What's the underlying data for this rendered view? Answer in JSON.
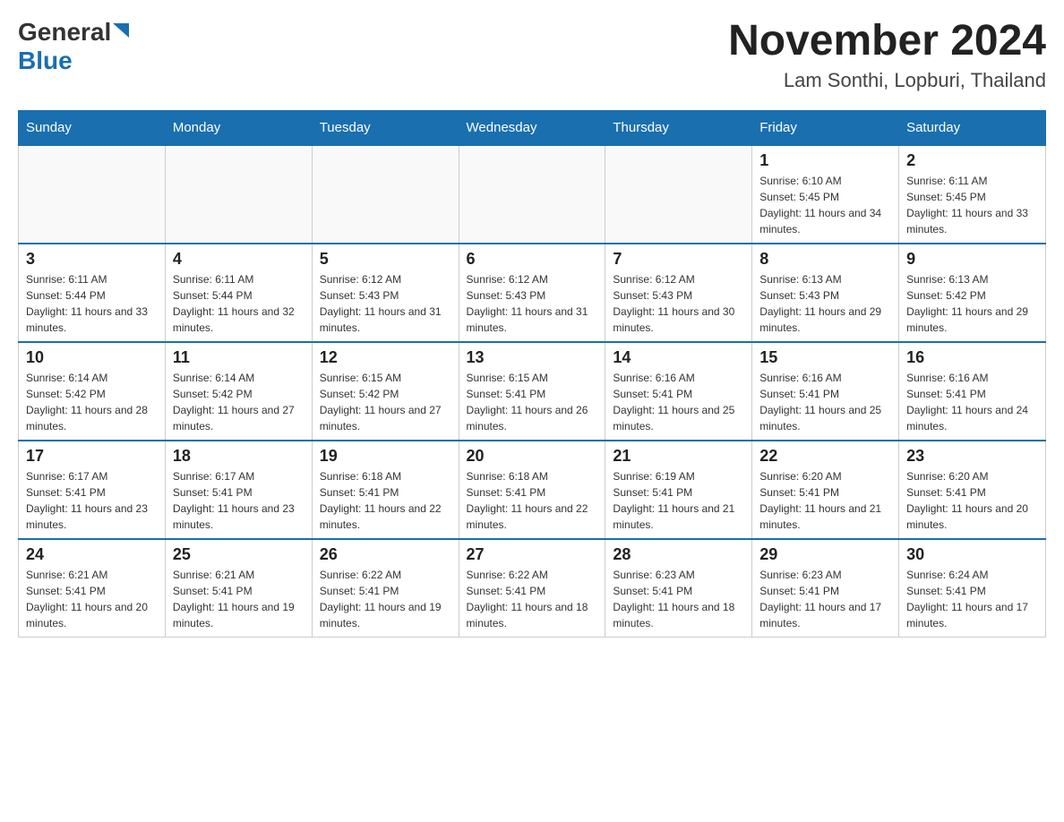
{
  "header": {
    "logo_general": "General",
    "logo_blue": "Blue",
    "title": "November 2024",
    "subtitle": "Lam Sonthi, Lopburi, Thailand"
  },
  "days_of_week": [
    "Sunday",
    "Monday",
    "Tuesday",
    "Wednesday",
    "Thursday",
    "Friday",
    "Saturday"
  ],
  "weeks": [
    {
      "days": [
        {
          "number": "",
          "info": ""
        },
        {
          "number": "",
          "info": ""
        },
        {
          "number": "",
          "info": ""
        },
        {
          "number": "",
          "info": ""
        },
        {
          "number": "",
          "info": ""
        },
        {
          "number": "1",
          "info": "Sunrise: 6:10 AM\nSunset: 5:45 PM\nDaylight: 11 hours and 34 minutes."
        },
        {
          "number": "2",
          "info": "Sunrise: 6:11 AM\nSunset: 5:45 PM\nDaylight: 11 hours and 33 minutes."
        }
      ]
    },
    {
      "days": [
        {
          "number": "3",
          "info": "Sunrise: 6:11 AM\nSunset: 5:44 PM\nDaylight: 11 hours and 33 minutes."
        },
        {
          "number": "4",
          "info": "Sunrise: 6:11 AM\nSunset: 5:44 PM\nDaylight: 11 hours and 32 minutes."
        },
        {
          "number": "5",
          "info": "Sunrise: 6:12 AM\nSunset: 5:43 PM\nDaylight: 11 hours and 31 minutes."
        },
        {
          "number": "6",
          "info": "Sunrise: 6:12 AM\nSunset: 5:43 PM\nDaylight: 11 hours and 31 minutes."
        },
        {
          "number": "7",
          "info": "Sunrise: 6:12 AM\nSunset: 5:43 PM\nDaylight: 11 hours and 30 minutes."
        },
        {
          "number": "8",
          "info": "Sunrise: 6:13 AM\nSunset: 5:43 PM\nDaylight: 11 hours and 29 minutes."
        },
        {
          "number": "9",
          "info": "Sunrise: 6:13 AM\nSunset: 5:42 PM\nDaylight: 11 hours and 29 minutes."
        }
      ]
    },
    {
      "days": [
        {
          "number": "10",
          "info": "Sunrise: 6:14 AM\nSunset: 5:42 PM\nDaylight: 11 hours and 28 minutes."
        },
        {
          "number": "11",
          "info": "Sunrise: 6:14 AM\nSunset: 5:42 PM\nDaylight: 11 hours and 27 minutes."
        },
        {
          "number": "12",
          "info": "Sunrise: 6:15 AM\nSunset: 5:42 PM\nDaylight: 11 hours and 27 minutes."
        },
        {
          "number": "13",
          "info": "Sunrise: 6:15 AM\nSunset: 5:41 PM\nDaylight: 11 hours and 26 minutes."
        },
        {
          "number": "14",
          "info": "Sunrise: 6:16 AM\nSunset: 5:41 PM\nDaylight: 11 hours and 25 minutes."
        },
        {
          "number": "15",
          "info": "Sunrise: 6:16 AM\nSunset: 5:41 PM\nDaylight: 11 hours and 25 minutes."
        },
        {
          "number": "16",
          "info": "Sunrise: 6:16 AM\nSunset: 5:41 PM\nDaylight: 11 hours and 24 minutes."
        }
      ]
    },
    {
      "days": [
        {
          "number": "17",
          "info": "Sunrise: 6:17 AM\nSunset: 5:41 PM\nDaylight: 11 hours and 23 minutes."
        },
        {
          "number": "18",
          "info": "Sunrise: 6:17 AM\nSunset: 5:41 PM\nDaylight: 11 hours and 23 minutes."
        },
        {
          "number": "19",
          "info": "Sunrise: 6:18 AM\nSunset: 5:41 PM\nDaylight: 11 hours and 22 minutes."
        },
        {
          "number": "20",
          "info": "Sunrise: 6:18 AM\nSunset: 5:41 PM\nDaylight: 11 hours and 22 minutes."
        },
        {
          "number": "21",
          "info": "Sunrise: 6:19 AM\nSunset: 5:41 PM\nDaylight: 11 hours and 21 minutes."
        },
        {
          "number": "22",
          "info": "Sunrise: 6:20 AM\nSunset: 5:41 PM\nDaylight: 11 hours and 21 minutes."
        },
        {
          "number": "23",
          "info": "Sunrise: 6:20 AM\nSunset: 5:41 PM\nDaylight: 11 hours and 20 minutes."
        }
      ]
    },
    {
      "days": [
        {
          "number": "24",
          "info": "Sunrise: 6:21 AM\nSunset: 5:41 PM\nDaylight: 11 hours and 20 minutes."
        },
        {
          "number": "25",
          "info": "Sunrise: 6:21 AM\nSunset: 5:41 PM\nDaylight: 11 hours and 19 minutes."
        },
        {
          "number": "26",
          "info": "Sunrise: 6:22 AM\nSunset: 5:41 PM\nDaylight: 11 hours and 19 minutes."
        },
        {
          "number": "27",
          "info": "Sunrise: 6:22 AM\nSunset: 5:41 PM\nDaylight: 11 hours and 18 minutes."
        },
        {
          "number": "28",
          "info": "Sunrise: 6:23 AM\nSunset: 5:41 PM\nDaylight: 11 hours and 18 minutes."
        },
        {
          "number": "29",
          "info": "Sunrise: 6:23 AM\nSunset: 5:41 PM\nDaylight: 11 hours and 17 minutes."
        },
        {
          "number": "30",
          "info": "Sunrise: 6:24 AM\nSunset: 5:41 PM\nDaylight: 11 hours and 17 minutes."
        }
      ]
    }
  ]
}
